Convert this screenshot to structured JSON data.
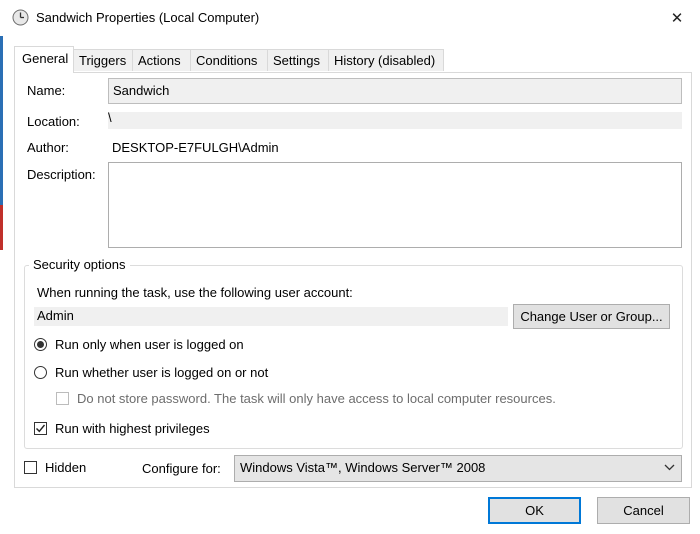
{
  "window": {
    "title": "Sandwich Properties (Local Computer)",
    "icon": "clock-icon",
    "close_glyph": "✕"
  },
  "tabs": [
    {
      "label": "General",
      "active": true
    },
    {
      "label": "Triggers",
      "active": false
    },
    {
      "label": "Actions",
      "active": false
    },
    {
      "label": "Conditions",
      "active": false
    },
    {
      "label": "Settings",
      "active": false
    },
    {
      "label": "History (disabled)",
      "active": false
    }
  ],
  "general": {
    "name_label": "Name:",
    "name_value": "Sandwich",
    "location_label": "Location:",
    "location_value": "\\",
    "author_label": "Author:",
    "author_value": "DESKTOP-E7FULGH\\Admin",
    "description_label": "Description:",
    "description_value": ""
  },
  "security": {
    "legend": "Security options",
    "account_prompt": "When running the task, use the following user account:",
    "account_value": "Admin",
    "change_button": "Change User or Group...",
    "radio_logged_on": "Run only when user is logged on",
    "radio_logged_on_selected": true,
    "radio_whether": "Run whether user is logged on or not",
    "radio_whether_selected": false,
    "no_store_password": "Do not store password.  The task will only have access to local computer resources.",
    "no_store_password_checked": false,
    "highest_privileges": "Run with highest privileges",
    "highest_privileges_checked": true
  },
  "bottom": {
    "hidden_label": "Hidden",
    "hidden_checked": false,
    "configure_label": "Configure for:",
    "configure_value": "Windows Vista™, Windows Server™ 2008"
  },
  "buttons": {
    "ok": "OK",
    "cancel": "Cancel"
  },
  "colors": {
    "focus_border": "#0078d7",
    "readonly_bg": "#f0f0f0",
    "button_bg": "#e1e1e1"
  }
}
